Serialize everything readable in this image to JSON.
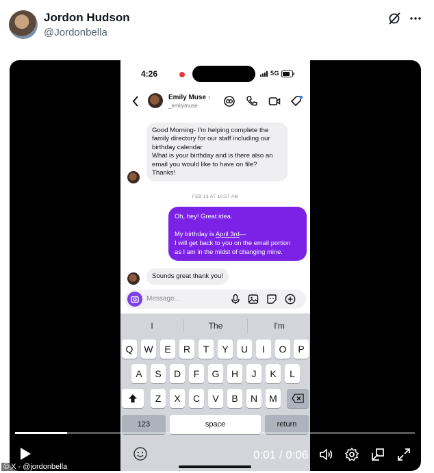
{
  "post": {
    "author_name": "Jordon Hudson",
    "author_handle": "@Jordonbella"
  },
  "phone": {
    "status_time": "4:26",
    "status_right": "5G",
    "contact_name": "Emily Muse",
    "contact_username": "_emilymuse",
    "messages": {
      "incoming_1_lines": [
        "Good Morning- I'm helping complete the",
        "family directory for our staff including our",
        "birthday calendar",
        "What is your birthday and is there also an",
        "email you would like to have on file?",
        "Thanks!"
      ],
      "timestamp": "FEB 13 AT 10:57 AM",
      "outgoing_line1": "Oh, hey! Great idea.",
      "outgoing_prefix": "My birthday is ",
      "outgoing_link": "April 3rd",
      "outgoing_suffix": "—",
      "outgoing_line3": "I will get back to you on the email portion",
      "outgoing_line4": "as I am in the midst of changing mine.",
      "incoming_2": "Sounds great thank you!"
    },
    "composer_placeholder": "Message...",
    "suggestions": [
      "I",
      "The",
      "I'm"
    ],
    "keyboard": {
      "row1": [
        "Q",
        "W",
        "E",
        "R",
        "T",
        "Y",
        "U",
        "I",
        "O",
        "P"
      ],
      "row2": [
        "A",
        "S",
        "D",
        "F",
        "G",
        "H",
        "J",
        "K",
        "L"
      ],
      "row3": [
        "Z",
        "X",
        "C",
        "V",
        "B",
        "N",
        "M"
      ],
      "numbers_label": "123",
      "space_label": "space",
      "return_label": "return"
    }
  },
  "video": {
    "current_time": "0:01",
    "separator": " / ",
    "duration": "0:06",
    "progress_fraction": 0.13,
    "watermark": "© X - @jordonbella"
  },
  "colors": {
    "accent_purple": "#7b22e6",
    "video_bg": "#000000"
  },
  "icons": [
    "grok-icon",
    "more-icon",
    "back-chevron-icon",
    "link-icon",
    "phone-icon",
    "video-call-icon",
    "tag-icon",
    "camera-icon",
    "mic-icon",
    "image-icon",
    "sticker-icon",
    "plus-icon",
    "shift-icon",
    "backspace-icon",
    "emoji-icon",
    "play-icon",
    "volume-icon",
    "settings-icon",
    "pip-icon",
    "fullscreen-icon"
  ]
}
